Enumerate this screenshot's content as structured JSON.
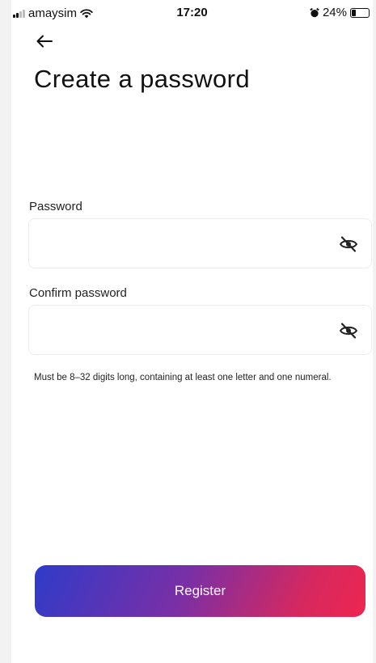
{
  "status_bar": {
    "carrier": "amaysim",
    "time": "17:20",
    "battery": "24%",
    "battery_level": 0.24
  },
  "header": {
    "back_icon": "arrow-left-icon",
    "title": "Create a password"
  },
  "form": {
    "password": {
      "label": "Password",
      "value": "",
      "placeholder": "",
      "toggle_icon": "eye-off-icon"
    },
    "confirm_password": {
      "label": "Confirm password",
      "value": "",
      "placeholder": "",
      "toggle_icon": "eye-off-icon"
    },
    "hint": "Must be 8–32 digits long, containing at least one letter and one numeral."
  },
  "actions": {
    "register_label": "Register"
  },
  "colors": {
    "gradient_start": "#2f3bc9",
    "gradient_end": "#ee2650",
    "text": "#111111"
  }
}
